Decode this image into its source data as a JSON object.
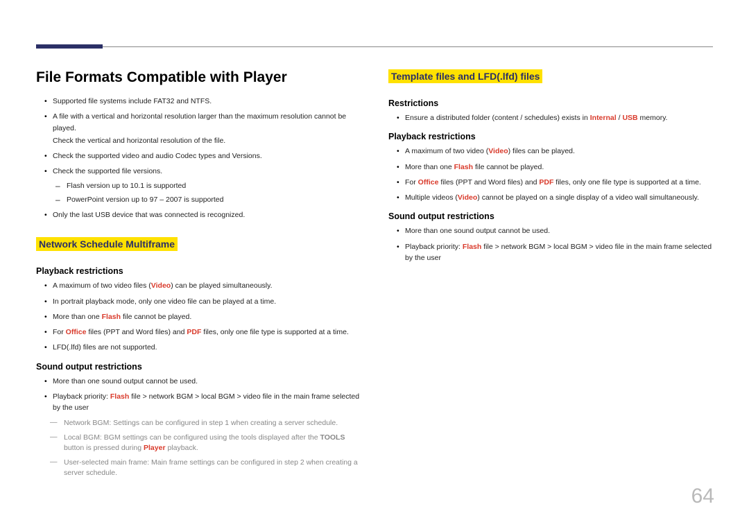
{
  "page_number": "64",
  "left": {
    "title": "File Formats Compatible with Player",
    "top_bullets": [
      {
        "html": "Supported file systems include FAT32 and NTFS."
      },
      {
        "html": "A file with a vertical and horizontal resolution larger than the maximum resolution cannot be played.",
        "note": "Check the vertical and horizontal resolution of the file."
      },
      {
        "html": "Check the supported video and audio Codec types and Versions."
      },
      {
        "html": "Check the supported file versions.",
        "dash": [
          "Flash version up to 10.1 is supported",
          "PowerPoint version up to 97 – 2007 is supported"
        ]
      },
      {
        "html": "Only the last USB device that was connected is recognized."
      }
    ],
    "section1_title": "Network Schedule Multiframe",
    "sub1_title": "Playback restrictions",
    "sub1_bullets": [
      "A maximum of two video files (<span class=\"red\">Video</span>) can be played simultaneously.",
      "In portrait playback mode, only one video file can be played at a time.",
      "More than one <span class=\"red\">Flash</span> file cannot be played.",
      "For <span class=\"red\">Office</span> files (PPT and Word files) and <span class=\"red\">PDF</span> files, only one file type is supported at a time.",
      "LFD(.lfd) files are not supported."
    ],
    "sub2_title": "Sound output restrictions",
    "sub2_bullets": [
      {
        "html": "More than one sound output cannot be used."
      },
      {
        "html": "Playback priority: <span class=\"red\">Flash</span> file > network BGM > local BGM > video file in the main frame selected by the user",
        "longdash": [
          "Network BGM: Settings can be configured in step 1 when creating a server schedule.",
          "Local BGM: BGM settings can be configured using the tools displayed after the <span class=\"bold\">TOOLS</span> button is pressed during <span class=\"red\">Player</span> playback.",
          "User-selected main frame: Main frame settings can be configured in step 2 when creating a server schedule."
        ]
      }
    ]
  },
  "right": {
    "section_title": "Template files and LFD(.lfd) files",
    "sub1_title": "Restrictions",
    "sub1_bullets": [
      "Ensure a distributed folder (content / schedules) exists in <span class=\"red\">Internal</span> / <span class=\"red\">USB</span> memory."
    ],
    "sub2_title": "Playback restrictions",
    "sub2_bullets": [
      "A maximum of two video (<span class=\"red\">Video</span>) files can be played.",
      "More than one <span class=\"red\">Flash</span> file cannot be played.",
      "For <span class=\"red\">Office</span> files (PPT and Word files) and <span class=\"red\">PDF</span> files, only one file type is supported at a time.",
      "Multiple videos (<span class=\"red\">Video</span>) cannot be played on a single display of a video wall simultaneously."
    ],
    "sub3_title": "Sound output restrictions",
    "sub3_bullets": [
      "More than one sound output cannot be used.",
      "Playback priority: <span class=\"red\">Flash</span> file > network BGM > local BGM > video file in the main frame selected by the user"
    ]
  }
}
